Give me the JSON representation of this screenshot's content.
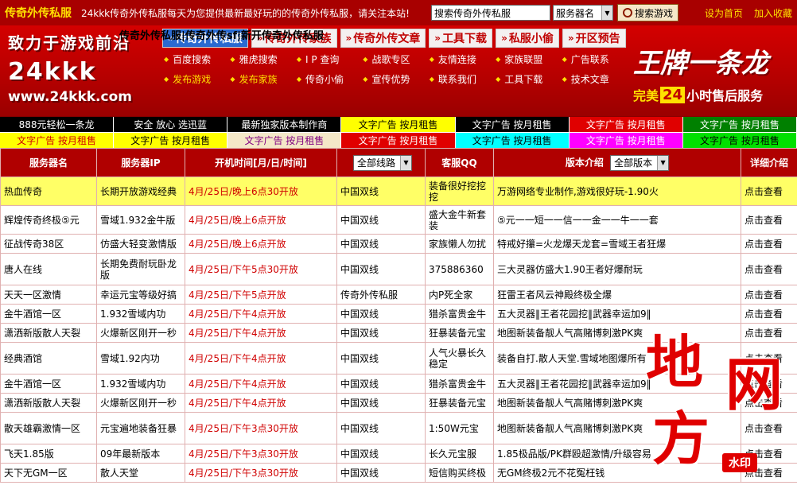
{
  "topbar": {
    "site_name": "传奇外传私服",
    "slogan": "24kkk传奇外传私服每天为您提供最新最好玩的的传奇外传私服，请关注本站!",
    "search_value": "搜索传奇外传私服",
    "server_select": "服务器名",
    "search_button": "搜索游戏",
    "set_home": "设为首页",
    "add_favorite": "加入收藏"
  },
  "banner": {
    "logo_line1": "致力于游戏前沿",
    "logo_line2": "24kkk",
    "logo_line3": "www.24kkk.com",
    "overlap_title": "传奇外传私服|传奇外传sf|新开传奇外传私服",
    "tabs": [
      {
        "label": "传奇外传私服"
      },
      {
        "label": "传奇外传家族"
      },
      {
        "label": "传奇外传文章"
      },
      {
        "label": "工具下载"
      },
      {
        "label": "私服小偷"
      },
      {
        "label": "开区预告"
      }
    ],
    "links": [
      "百度搜索",
      "雅虎搜索",
      "I P 查询",
      "战歌专区",
      "友情连接",
      "家族联盟",
      "广告联系",
      "发布游戏",
      "发布家族",
      "传奇小偷",
      "宣传优势",
      "联系我们",
      "工具下载",
      "技术文章"
    ],
    "brand_big": "王牌一条龙",
    "brand_prefix": "完美",
    "brand_num": "24",
    "brand_suffix": "小时售后服务"
  },
  "ads": {
    "row1": [
      {
        "text": "888元轻松一条龙",
        "bg": "#000000",
        "fg": "#ffffff"
      },
      {
        "text": "安全 放心 选迅蓝",
        "bg": "#000000",
        "fg": "#ffffff"
      },
      {
        "text": "最新独家版本制作商",
        "bg": "#000000",
        "fg": "#ffffff"
      },
      {
        "text": "文字广告 按月租售",
        "bg": "#ffff00",
        "fg": "#000000"
      },
      {
        "text": "文字广告 按月租售",
        "bg": "#000000",
        "fg": "#ffffff"
      },
      {
        "text": "文字广告 按月租售",
        "bg": "#e00000",
        "fg": "#ffffff"
      },
      {
        "text": "文字广告 按月租售",
        "bg": "#008000",
        "fg": "#ffffff"
      }
    ],
    "row2": [
      {
        "text": "文字广告 按月租售",
        "bg": "#ffff00",
        "fg": "#d00000"
      },
      {
        "text": "文字广告 按月租售",
        "bg": "#ffff00",
        "fg": "#000000"
      },
      {
        "text": "文字广告 按月租售",
        "bg": "#f4e8c8",
        "fg": "#800080"
      },
      {
        "text": "文字广告 按月租售",
        "bg": "#e00000",
        "fg": "#ffffff"
      },
      {
        "text": "文字广告 按月租售",
        "bg": "#00ffff",
        "fg": "#000000"
      },
      {
        "text": "文字广告 按月租售",
        "bg": "#ff00ff",
        "fg": "#ffffff"
      },
      {
        "text": "文字广告 按月租售",
        "bg": "#00e000",
        "fg": "#000000"
      }
    ]
  },
  "table": {
    "headers": {
      "name": "服务器名",
      "ip": "服务器IP",
      "time": "开机时间[月/日/时间]",
      "line": "全部线路",
      "qq": "客服QQ",
      "version_label": "版本介绍",
      "version_select": "全部版本",
      "detail": "详细介绍"
    },
    "rows": [
      {
        "name": "热血传奇",
        "ip": "长期开放游戏经典",
        "time": "4月/25日/晚上6点30开放",
        "line": "中国双线",
        "qq": "装备很好挖挖挖",
        "version": "万游网络专业制作,游戏很好玩-1.90火",
        "detail": "点击查看",
        "hot": true
      },
      {
        "name": "辉煌传奇终极⑤元",
        "ip": "雪域1.932金牛版",
        "time": "4月/25日/晚上6点开放",
        "line": "中国双线",
        "qq": "盛大金牛新套装",
        "version": "⑤元一一短一一信一一金一一牛一一套",
        "detail": "点击查看",
        "hot": false
      },
      {
        "name": "征战传奇38区",
        "ip": "仿盛大轻变激情版",
        "time": "4月/25日/晚上6点开放",
        "line": "中国双线",
        "qq": "家族懒人勿扰",
        "version": "特戒好攥=火龙爆天龙套=雪域王者狂爆",
        "detail": "点击查看",
        "hot": false
      },
      {
        "name": "唐人在线",
        "ip": "长期免费耐玩卧龙版",
        "time": "4月/25日/下午5点30开放",
        "line": "中国双线",
        "qq": "375886360",
        "version": "三大灵器仿盛大1.90王者好爆耐玩",
        "detail": "点击查看",
        "hot": false
      },
      {
        "name": "天天一区激情",
        "ip": "幸运元宝等级好搞",
        "time": "4月/25日/下午5点开放",
        "line": "传奇外传私服",
        "qq": "内P死全家",
        "version": "狂雷王者风云神殿终极全爆",
        "detail": "点击查看",
        "hot": false
      },
      {
        "name": "金牛酒馆一区",
        "ip": "1.932雪域内功",
        "time": "4月/25日/下午4点开放",
        "line": "中国双线",
        "qq": "猎杀富贵金牛",
        "version": "五大灵器‖王者花园挖‖武器幸运加9‖",
        "detail": "点击查看",
        "hot": false
      },
      {
        "name": "潇洒新版散人天裂",
        "ip": "火爆新区刚开一秒",
        "time": "4月/25日/下午4点开放",
        "line": "中国双线",
        "qq": "狂暴装备元宝",
        "version": "地图新装备靓人气高赌博刺激PK爽",
        "detail": "点击查看",
        "hot": false
      },
      {
        "name": "经典酒馆",
        "ip": "雪域1.92内功",
        "time": "4月/25日/下午4点开放",
        "line": "中国双线",
        "qq": "人气火暴长久稳定",
        "version": "装备自打.散人天堂.雪域地图爆所有",
        "detail": "点击查看",
        "hot": false
      },
      {
        "name": "金牛酒馆一区",
        "ip": "1.932雪域内功",
        "time": "4月/25日/下午4点开放",
        "line": "中国双线",
        "qq": "猎杀富贵金牛",
        "version": "五大灵器‖王者花园挖‖武器幸运加9‖",
        "detail": "点击查看",
        "hot": false
      },
      {
        "name": "潇洒新版散人天裂",
        "ip": "火爆新区刚开一秒",
        "time": "4月/25日/下午4点开放",
        "line": "中国双线",
        "qq": "狂暴装备元宝",
        "version": "地图新装备靓人气高赌博刺激PK爽",
        "detail": "点击查看",
        "hot": false
      },
      {
        "name": "散天雄霸激情一区",
        "ip": "元宝遍地装备狂暴",
        "time": "4月/25日/下午3点30开放",
        "line": "中国双线",
        "qq": "1:50W元宝",
        "version": "地图新装备靓人气高赌博刺激PK爽",
        "detail": "点击查看",
        "hot": false
      },
      {
        "name": "飞天1.85版",
        "ip": "09年最新版本",
        "time": "4月/25日/下午3点30开放",
        "line": "中国双线",
        "qq": "长久元宝服",
        "version": "1.85极品版/PK群殴超激情/升级容易",
        "detail": "点击查看",
        "hot": false
      },
      {
        "name": "天下无GM一区",
        "ip": "散人天堂",
        "time": "4月/25日/下午3点30开放",
        "line": "中国双线",
        "qq": "短信购买终极",
        "version": "无GM终极2元不花冤枉钱",
        "detail": "点击查看",
        "hot": false
      }
    ]
  },
  "watermark": {
    "ch1": "地",
    "ch2": "网",
    "ch3": "方",
    "stamp": "水印"
  }
}
